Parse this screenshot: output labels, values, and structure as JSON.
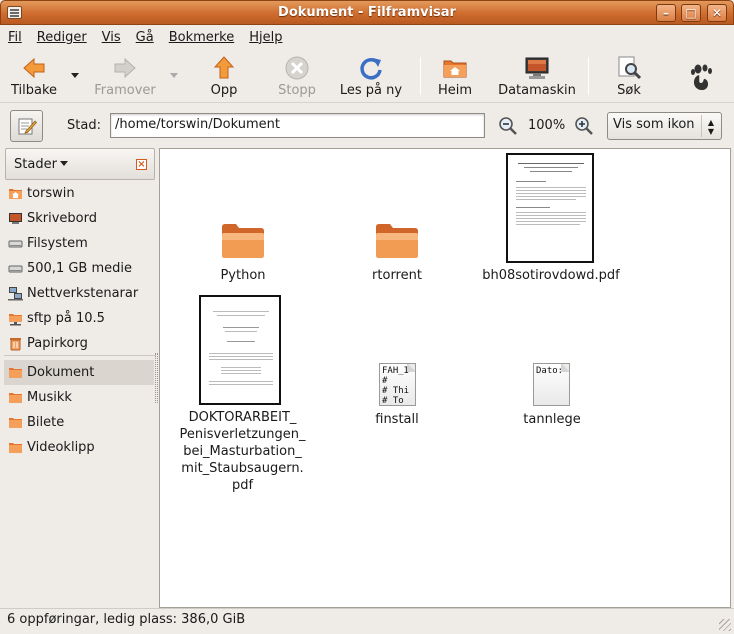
{
  "window": {
    "title": "Dokument - Filframvisar"
  },
  "menu": [
    "Fil",
    "Rediger",
    "Vis",
    "Gå",
    "Bokmerke",
    "Hjelp"
  ],
  "toolbar": {
    "back": "Tilbake",
    "forward": "Framover",
    "up": "Opp",
    "stop": "Stopp",
    "reload": "Les på ny",
    "home": "Heim",
    "computer": "Datamaskin",
    "search": "Søk"
  },
  "location": {
    "label": "Stad:",
    "path": "/home/torswin/Dokument",
    "zoom": "100%",
    "view_mode": "Vis som ikon"
  },
  "sidebar": {
    "header": "Stader",
    "items": [
      {
        "label": "torswin",
        "icon": "home-folder-icon"
      },
      {
        "label": "Skrivebord",
        "icon": "desktop-icon"
      },
      {
        "label": "Filsystem",
        "icon": "drive-icon"
      },
      {
        "label": "500,1 GB medie",
        "icon": "drive-icon"
      },
      {
        "label": "Nettverkstenarar",
        "icon": "network-icon"
      },
      {
        "label": "sftp på 10.5",
        "icon": "network-folder-icon"
      },
      {
        "label": "Papirkorg",
        "icon": "trash-icon"
      },
      {
        "label": "Dokument",
        "icon": "folder-icon",
        "selected": true
      },
      {
        "label": "Musikk",
        "icon": "folder-icon"
      },
      {
        "label": "Bilete",
        "icon": "folder-icon"
      },
      {
        "label": "Videoklipp",
        "icon": "folder-icon"
      }
    ]
  },
  "files": [
    {
      "name": "Python",
      "type": "folder"
    },
    {
      "name": "rtorrent",
      "type": "folder"
    },
    {
      "name": "bh08sotirovdowd.pdf",
      "type": "pdf"
    },
    {
      "name_lines": [
        "DOKTORARBEIT_",
        "Penisverletzungen_",
        "bei_Masturbation_",
        "mit_Staubsaugern.",
        "pdf"
      ],
      "type": "pdf"
    },
    {
      "name": "finstall",
      "type": "text",
      "preview": [
        "FAH_I",
        "#",
        "# Thi",
        "# To"
      ]
    },
    {
      "name": "tannlege",
      "type": "text",
      "preview": [
        "Dato:"
      ]
    }
  ],
  "status": "6 oppføringar, ledig plass: 386,0 GiB",
  "colors": {
    "accent": "#cf6c2f",
    "folder": "#f09a4c",
    "selection": "#dad5cf"
  }
}
